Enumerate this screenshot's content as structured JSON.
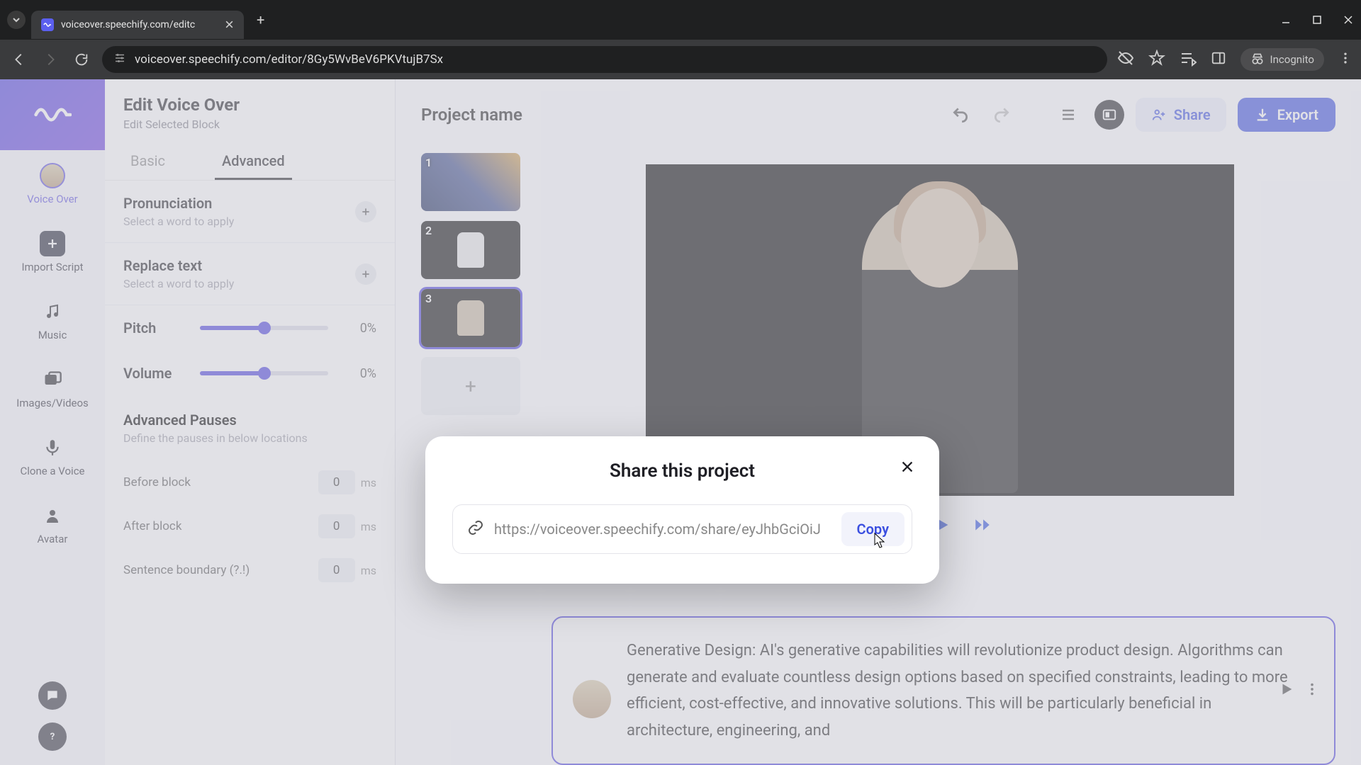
{
  "browser": {
    "tab_title": "voiceover.speechify.com/editc",
    "url": "voiceover.speechify.com/editor/8Gy5WvBeV6PKVtujB7Sx",
    "incognito": "Incognito"
  },
  "rail": {
    "voice_over": "Voice Over",
    "import_script": "Import Script",
    "music": "Music",
    "images_videos": "Images/Videos",
    "clone_voice": "Clone a Voice",
    "avatar": "Avatar"
  },
  "settings": {
    "title": "Edit Voice Over",
    "subtitle": "Edit Selected Block",
    "tab_basic": "Basic",
    "tab_advanced": "Advanced",
    "pronunciation": {
      "title": "Pronunciation",
      "hint": "Select a word to apply"
    },
    "replace": {
      "title": "Replace text",
      "hint": "Select a word to apply"
    },
    "pitch": {
      "label": "Pitch",
      "value": "0%"
    },
    "volume": {
      "label": "Volume",
      "value": "0%"
    },
    "pauses": {
      "title": "Advanced Pauses",
      "hint": "Define the pauses in below locations",
      "before": {
        "label": "Before block",
        "value": "0",
        "unit": "ms"
      },
      "after": {
        "label": "After block",
        "value": "0",
        "unit": "ms"
      },
      "sentence": {
        "label": "Sentence boundary (?.!)",
        "value": "0",
        "unit": "ms"
      }
    }
  },
  "main": {
    "project_name": "Project name",
    "share": "Share",
    "export": "Export",
    "thumbs": {
      "n1": "1",
      "n2": "2",
      "n3": "3"
    },
    "script": "Generative Design: AI's generative capabilities will revolutionize product design. Algorithms can generate and evaluate countless design options based on specified constraints, leading to more efficient, cost-effective, and innovative solutions. This will be particularly beneficial in architecture, engineering, and"
  },
  "modal": {
    "title": "Share this project",
    "link": "https://voiceover.speechify.com/share/eyJhbGciOiJ",
    "copy": "Copy"
  }
}
